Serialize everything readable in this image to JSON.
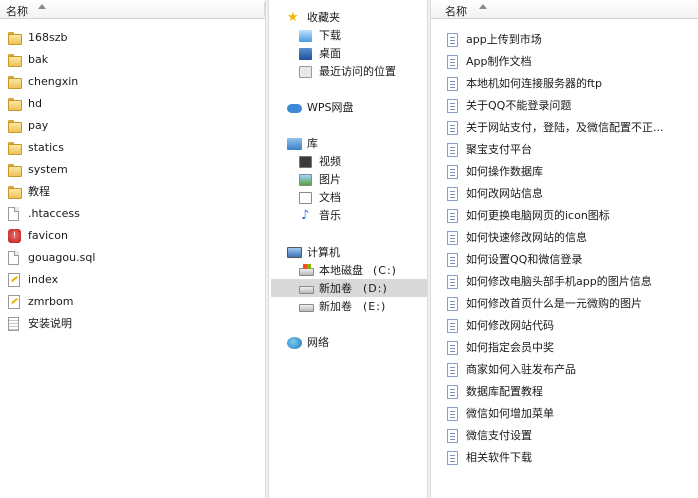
{
  "left_pane": {
    "header": "名称",
    "items": [
      {
        "label": "168szb",
        "icon": "folder-icon"
      },
      {
        "label": "bak",
        "icon": "folder-icon"
      },
      {
        "label": "chengxin",
        "icon": "folder-icon"
      },
      {
        "label": "hd",
        "icon": "folder-icon"
      },
      {
        "label": "pay",
        "icon": "folder-icon"
      },
      {
        "label": "statics",
        "icon": "folder-icon"
      },
      {
        "label": "system",
        "icon": "folder-icon"
      },
      {
        "label": "教程",
        "icon": "folder-icon"
      },
      {
        "label": ".htaccess",
        "icon": "file-icon"
      },
      {
        "label": "favicon",
        "icon": "favicon-file-icon"
      },
      {
        "label": "gouagou.sql",
        "icon": "file-icon"
      },
      {
        "label": "index",
        "icon": "script-file-icon"
      },
      {
        "label": "zmrbom",
        "icon": "script-file-icon"
      },
      {
        "label": "安装说明",
        "icon": "text-file-icon"
      }
    ]
  },
  "nav_pane": {
    "favorites": {
      "label": "收藏夹",
      "items": [
        {
          "label": "下载",
          "icon": "downloads-icon"
        },
        {
          "label": "桌面",
          "icon": "desktop-icon"
        },
        {
          "label": "最近访问的位置",
          "icon": "recent-places-icon"
        }
      ]
    },
    "wps": {
      "label": "WPS网盘",
      "icon": "cloud-icon"
    },
    "libraries": {
      "label": "库",
      "items": [
        {
          "label": "视频",
          "icon": "video-library-icon"
        },
        {
          "label": "图片",
          "icon": "picture-library-icon"
        },
        {
          "label": "文档",
          "icon": "document-library-icon"
        },
        {
          "label": "音乐",
          "icon": "music-library-icon"
        }
      ]
    },
    "computer": {
      "label": "计算机",
      "items": [
        {
          "label": "本地磁盘",
          "letter": "(C:)",
          "icon": "system-drive-icon"
        },
        {
          "label": "新加卷",
          "letter": "(D:)",
          "icon": "drive-icon",
          "selected": true
        },
        {
          "label": "新加卷",
          "letter": "(E:)",
          "icon": "drive-icon"
        }
      ]
    },
    "network": {
      "label": "网络",
      "icon": "network-icon"
    }
  },
  "right_pane": {
    "header": "名称",
    "items": [
      "app上传到市场",
      "App制作文档",
      "本地机如何连接服务器的ftp",
      "关于QQ不能登录问题",
      "关于网站支付，登陆，及微信配置不正...",
      "聚宝支付平台",
      "如何操作数据库",
      "如何改网站信息",
      "如何更换电脑网页的icon图标",
      "如何快速修改网站的信息",
      "如何设置QQ和微信登录",
      "如何修改电脑头部手机app的图片信息",
      "如何修改首页什么是一元微购的图片",
      "如何修改网站代码",
      "如何指定会员中奖",
      "商家如何入驻发布产品",
      "数据库配置教程",
      "微信如何增加菜单",
      "微信支付设置",
      "相关软件下载"
    ]
  }
}
